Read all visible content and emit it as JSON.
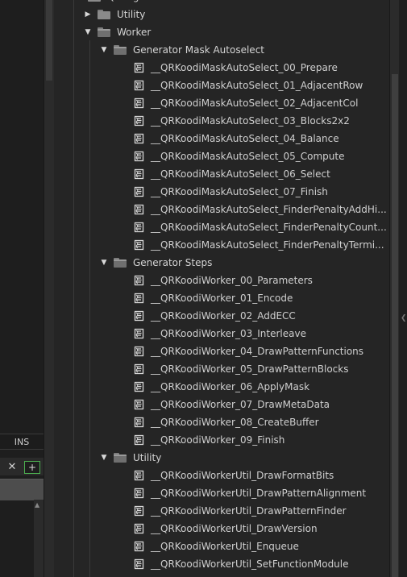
{
  "left_panel": {
    "ins_label": "INS",
    "close_glyph": "✕",
    "add_glyph": "+"
  },
  "tree": {
    "top_partial": {
      "label": "Q...ing"
    },
    "utility_top": {
      "label": "Utility",
      "expanded": false
    },
    "worker": {
      "label": "Worker",
      "expanded": true,
      "groups": [
        {
          "label": "Generator Mask Autoselect",
          "items": [
            "__QRKoodiMaskAutoSelect_00_Prepare",
            "__QRKoodiMaskAutoSelect_01_AdjacentRow",
            "__QRKoodiMaskAutoSelect_02_AdjacentCol",
            "__QRKoodiMaskAutoSelect_03_Blocks2x2",
            "__QRKoodiMaskAutoSelect_04_Balance",
            "__QRKoodiMaskAutoSelect_05_Compute",
            "__QRKoodiMaskAutoSelect_06_Select",
            "__QRKoodiMaskAutoSelect_07_Finish",
            "__QRKoodiMaskAutoSelect_FinderPenaltyAddHi...",
            "__QRKoodiMaskAutoSelect_FinderPenaltyCount...",
            "__QRKoodiMaskAutoSelect_FinderPenaltyTermi..."
          ]
        },
        {
          "label": "Generator Steps",
          "items": [
            "__QRKoodiWorker_00_Parameters",
            "__QRKoodiWorker_01_Encode",
            "__QRKoodiWorker_02_AddECC",
            "__QRKoodiWorker_03_Interleave",
            "__QRKoodiWorker_04_DrawPatternFunctions",
            "__QRKoodiWorker_05_DrawPatternBlocks",
            "__QRKoodiWorker_06_ApplyMask",
            "__QRKoodiWorker_07_DrawMetaData",
            "__QRKoodiWorker_08_CreateBuffer",
            "__QRKoodiWorker_09_Finish"
          ]
        },
        {
          "label": "Utility",
          "items": [
            "__QRKoodiWorkerUtil_DrawFormatBits",
            "__QRKoodiWorkerUtil_DrawPatternAlignment",
            "__QRKoodiWorkerUtil_DrawPatternFinder",
            "__QRKoodiWorkerUtil_DrawVersion",
            "__QRKoodiWorkerUtil_Enqueue",
            "__QRKoodiWorkerUtil_SetFunctionModule"
          ]
        }
      ]
    }
  }
}
